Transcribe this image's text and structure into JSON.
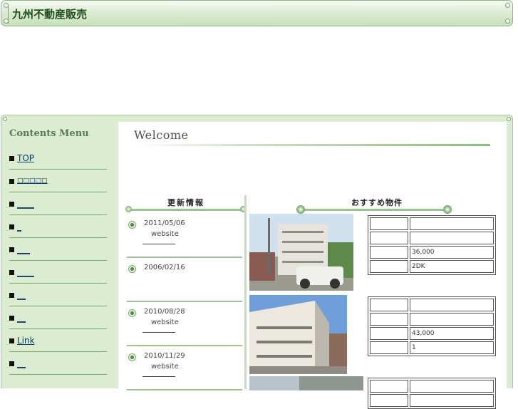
{
  "site": {
    "title": "九州不動産販売"
  },
  "sidebar": {
    "title": "Contents Menu",
    "items": [
      {
        "label": "TOP"
      },
      {
        "label": "□□□□□"
      },
      {
        "label": "____"
      },
      {
        "label": "_"
      },
      {
        "label": "___"
      },
      {
        "label": "____"
      },
      {
        "label": "__"
      },
      {
        "label": "__"
      },
      {
        "label": "Link"
      },
      {
        "label": "__"
      }
    ]
  },
  "main": {
    "welcome": "Welcome",
    "news": {
      "title": "更新情報",
      "items": [
        {
          "date": "2011/05/06",
          "text": "website"
        },
        {
          "date": "2006/02/16",
          "text": ""
        },
        {
          "date": "2010/08/28",
          "text": "website"
        },
        {
          "date": "2010/11/29",
          "text": "website"
        }
      ]
    },
    "recommend": {
      "title": "おすすめ物件",
      "properties": [
        {
          "rows": [
            "",
            "",
            "36,000",
            "2DK"
          ]
        },
        {
          "rows": [
            "",
            "",
            "43,000",
            "1"
          ]
        },
        {
          "rows": [
            "",
            ""
          ]
        }
      ]
    }
  },
  "colors": {
    "accent_green": "#9cc48f",
    "frame_green": "#dcecd0",
    "link": "#0a3a6a"
  }
}
